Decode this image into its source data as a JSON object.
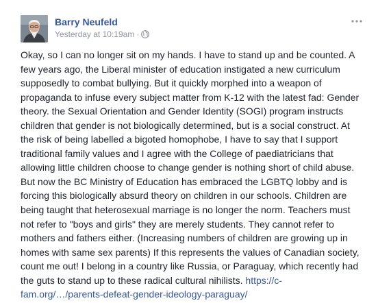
{
  "post": {
    "author": "Barry Neufeld",
    "timestamp": "Yesterday at 10:19am",
    "separator": "·",
    "privacy_icon": "globe-icon",
    "menu_icon": "more-options-icon",
    "body": "Okay, so I can no longer sit on my hands. I have to stand up and be counted. A few years ago, the Liberal minister of education instigated a new curriculum supposedly to combat bullying. But it quickly morphed into a weapon of propaganda to infuse every subject matter from K-12 with the latest fad: Gender theory. the Sexual Orientation and Gender Identity (SOGI) program instructs children that gender is not biologically determined, but is a social construct. At the risk of being labelled a bigoted homophobe, I have to say that I support traditional family values and I agree with the College of paediatricians that allowing little children choose to change gender is nothing short of child abuse. But now the BC Ministry of Education has embraced the LGBTQ lobby and is forcing this biologically absurd theory on children in our schools. Children are being taught that heterosexual marriage is no longer the norm. Teachers must not refer to \"boys and girls\" they are merely students. They cannot refer to mothers and fathers either. (Increasing numbers of children are growing up in homes with same sex parents) If this represents the values of Canadian society, count me out! I belong in a country like Russia, or Paraguay, which recently had the guts to stand up to these radical cultural nihilists.",
    "link_text": "https://c-fam.org/…/parents-defeat-gender-ideology-paraguay/"
  },
  "colors": {
    "author_link": "#365899",
    "body_text": "#1d2129",
    "meta_text": "#90949c",
    "link": "#365899"
  }
}
